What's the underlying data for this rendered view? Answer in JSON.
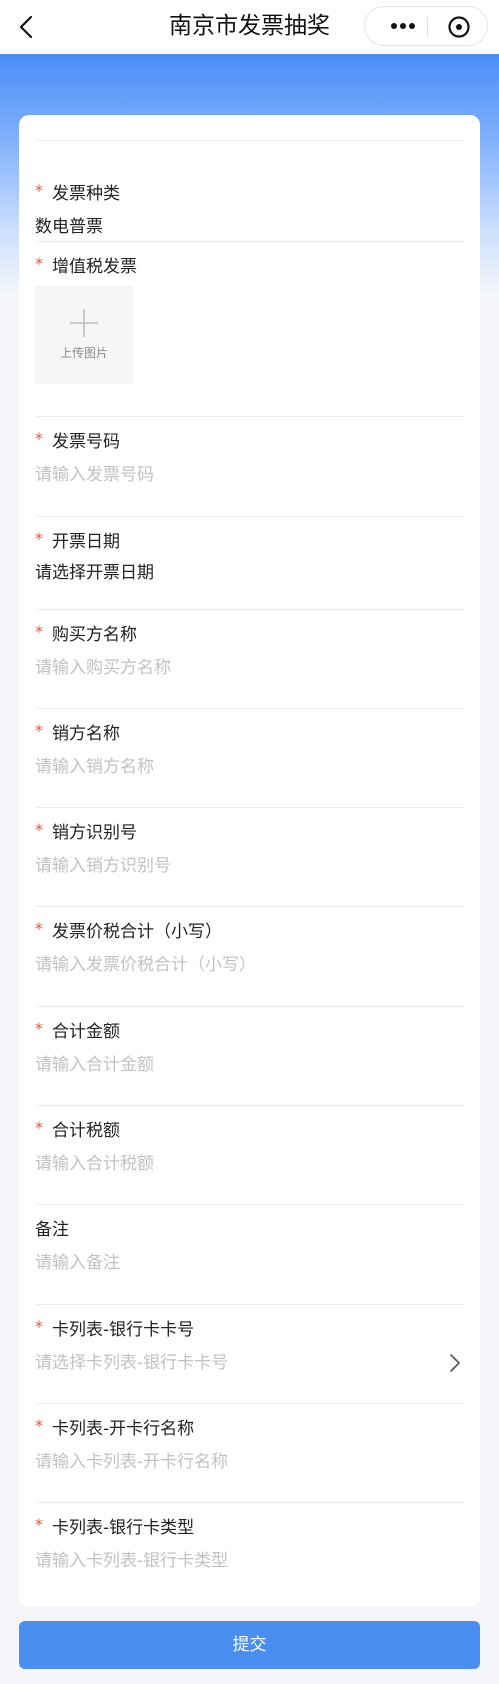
{
  "header": {
    "title": "南京市发票抽奖"
  },
  "form": {
    "fields": [
      {
        "label": "发票种类",
        "required": true,
        "value": "数电普票"
      },
      {
        "label": "增值税发票",
        "required": true,
        "upload_text": "上传图片"
      },
      {
        "label": "发票号码",
        "required": true,
        "placeholder": "请输入发票号码"
      },
      {
        "label": "开票日期",
        "required": true,
        "value": "请选择开票日期"
      },
      {
        "label": "购买方名称",
        "required": true,
        "placeholder": "请输入购买方名称"
      },
      {
        "label": "销方名称",
        "required": true,
        "placeholder": "请输入销方名称"
      },
      {
        "label": "销方识别号",
        "required": true,
        "placeholder": "请输入销方识别号"
      },
      {
        "label": "发票价税合计（小写）",
        "required": true,
        "placeholder": "请输入发票价税合计（小写）"
      },
      {
        "label": "合计金额",
        "required": true,
        "placeholder": "请输入合计金额"
      },
      {
        "label": "合计税额",
        "required": true,
        "placeholder": "请输入合计税额"
      },
      {
        "label": "备注",
        "required": false,
        "placeholder": "请输入备注"
      },
      {
        "label": "卡列表-银行卡卡号",
        "required": true,
        "placeholder": "请选择卡列表-银行卡卡号"
      },
      {
        "label": "卡列表-开卡行名称",
        "required": true,
        "placeholder": "请输入卡列表-开卡行名称"
      },
      {
        "label": "卡列表-银行卡类型",
        "required": true,
        "placeholder": "请输入卡列表-银行卡类型"
      }
    ],
    "required_mark": "*"
  },
  "submit_label": "提交",
  "colors": {
    "accent": "#4a8ef2",
    "required": "#e8553c",
    "placeholder": "#c2c2c2"
  }
}
